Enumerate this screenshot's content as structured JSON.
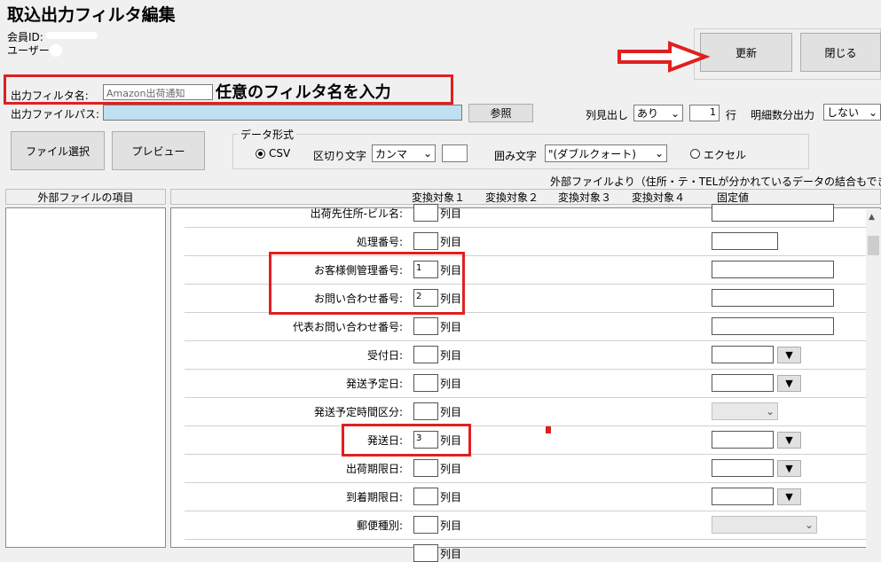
{
  "window": {
    "title": "取込出力フィルタ編集"
  },
  "member": {
    "id_label": "会員ID:",
    "user_label": "ユーザー:"
  },
  "buttons": {
    "update": "更新",
    "close": "閉じる",
    "file_select": "ファイル選択",
    "preview": "プレビュー",
    "browse": "参照"
  },
  "filter": {
    "name_label": "出力フィルタ名:",
    "name_value": "Amazon出荷通知",
    "annotation": "任意のフィルタ名を入力",
    "path_label": "出力ファイルパス:"
  },
  "options": {
    "column_header_label": "列見出し",
    "column_header_value": "あり",
    "row_value": "1",
    "row_label": "行",
    "detail_label": "明細数分出力",
    "detail_value": "しない"
  },
  "data_format": {
    "group_label": "データ形式",
    "csv_label": "CSV",
    "delimiter_label": "区切り文字",
    "delimiter_value": "カンマ",
    "quote_label": "囲み文字",
    "quote_value": "\"(ダブルクォート)",
    "excel_label": "エクセル"
  },
  "note": "外部ファイルより（住所・テ・TELが分かれているデータの結合もできます。）",
  "external_panel": {
    "header": "外部ファイルの項目"
  },
  "columns": {
    "conv1": "変換対象１",
    "conv2": "変換対象２",
    "conv3": "変換対象３",
    "conv4": "変換対象４",
    "fixed": "固定値"
  },
  "retsu": "列目",
  "rows": [
    {
      "label": "出荷先住所-ビル名:",
      "num": "",
      "fixed": "text-wide"
    },
    {
      "label": "処理番号:",
      "num": "",
      "fixed": "text-short"
    },
    {
      "label": "お客様側管理番号:",
      "num": "1",
      "fixed": "text-wide"
    },
    {
      "label": "お問い合わせ番号:",
      "num": "2",
      "fixed": "text-wide"
    },
    {
      "label": "代表お問い合わせ番号:",
      "num": "",
      "fixed": "text-wide"
    },
    {
      "label": "受付日:",
      "num": "",
      "fixed": "date"
    },
    {
      "label": "発送予定日:",
      "num": "",
      "fixed": "date"
    },
    {
      "label": "発送予定時間区分:",
      "num": "",
      "fixed": "combo"
    },
    {
      "label": "発送日:",
      "num": "3",
      "fixed": "date"
    },
    {
      "label": "出荷期限日:",
      "num": "",
      "fixed": "date"
    },
    {
      "label": "到着期限日:",
      "num": "",
      "fixed": "date"
    },
    {
      "label": "郵便種別:",
      "num": "",
      "fixed": "combo-wide"
    },
    {
      "label": "",
      "num": "",
      "fixed": "none"
    }
  ],
  "colors": {
    "highlight": "#e02020",
    "path_field": "#bfe0f0"
  }
}
